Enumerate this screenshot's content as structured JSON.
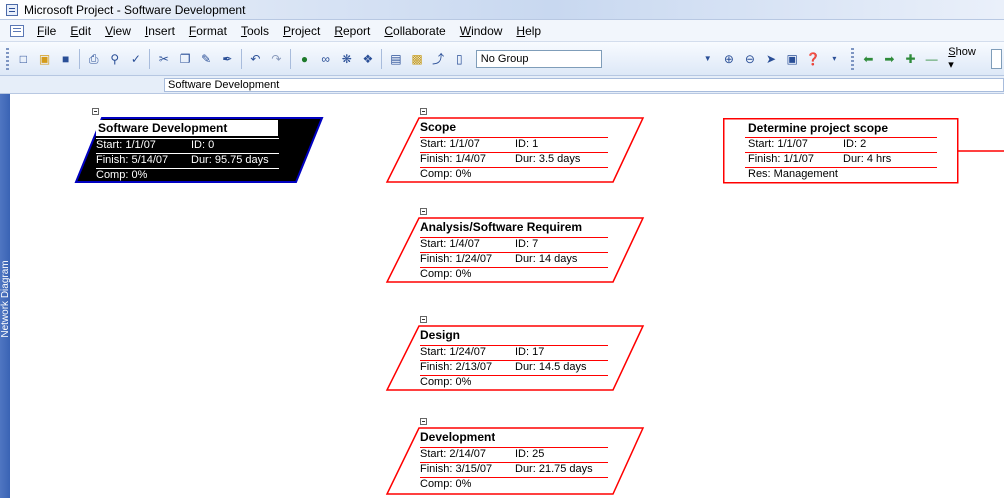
{
  "window": {
    "title": "Microsoft Project - Software Development"
  },
  "menu": {
    "items": [
      "File",
      "Edit",
      "View",
      "Insert",
      "Format",
      "Tools",
      "Project",
      "Report",
      "Collaborate",
      "Window",
      "Help"
    ]
  },
  "toolbar": {
    "group_value": "No Group",
    "show_label": "Show",
    "icons": [
      "new-icon",
      "open-icon",
      "save-icon",
      "print-icon",
      "print-preview-icon",
      "spelling-icon",
      "cut-icon",
      "copy-icon",
      "paste-icon",
      "format-painter-icon",
      "undo-icon",
      "redo-icon",
      "link-tasks-icon",
      "unlink-icon",
      "split-task-icon",
      "task-info-icon",
      "notes-icon",
      "assign-resources-icon",
      "publish-icon",
      "zoom-in-icon",
      "zoom-out-icon",
      "go-to-task-icon",
      "copy-picture-icon",
      "help-icon",
      "scroll-left-icon",
      "scroll-right-icon",
      "expand-icon",
      "collapse-icon"
    ]
  },
  "entry_bar": {
    "value": "Software Development"
  },
  "view_bar": {
    "label": "Network Diagram"
  },
  "nodes": [
    {
      "id": "n0",
      "name": "Software Development",
      "start": "Start: 1/1/07",
      "id_text": "ID: 0",
      "finish": "Finish: 5/14/07",
      "dur": "Dur: 95.75 days",
      "comp": "Comp: 0%",
      "style": "summary-selected"
    },
    {
      "id": "n1",
      "name": "Scope",
      "start": "Start: 1/1/07",
      "id_text": "ID: 1",
      "finish": "Finish: 1/4/07",
      "dur": "Dur: 3.5 days",
      "comp": "Comp: 0%",
      "style": "summary"
    },
    {
      "id": "n2",
      "name": "Analysis/Software Requirem",
      "start": "Start: 1/4/07",
      "id_text": "ID: 7",
      "finish": "Finish: 1/24/07",
      "dur": "Dur: 14 days",
      "comp": "Comp: 0%",
      "style": "summary"
    },
    {
      "id": "n3",
      "name": "Design",
      "start": "Start: 1/24/07",
      "id_text": "ID: 17",
      "finish": "Finish: 2/13/07",
      "dur": "Dur: 14.5 days",
      "comp": "Comp: 0%",
      "style": "summary"
    },
    {
      "id": "n4",
      "name": "Development",
      "start": "Start: 2/14/07",
      "id_text": "ID: 25",
      "finish": "Finish: 3/15/07",
      "dur": "Dur: 21.75 days",
      "comp": "Comp: 0%",
      "style": "summary"
    },
    {
      "id": "n5",
      "name": "Determine project scope",
      "start": "Start: 1/1/07",
      "id_text": "ID: 2",
      "finish": "Finish: 1/1/07",
      "dur": "Dur: 4 hrs",
      "res": "Res:  Management",
      "style": "task"
    }
  ],
  "colors": {
    "critical": "#ff0000",
    "selected_fill": "#000000",
    "selected_border": "#0000c0",
    "view_bar": "#3a63b4"
  }
}
